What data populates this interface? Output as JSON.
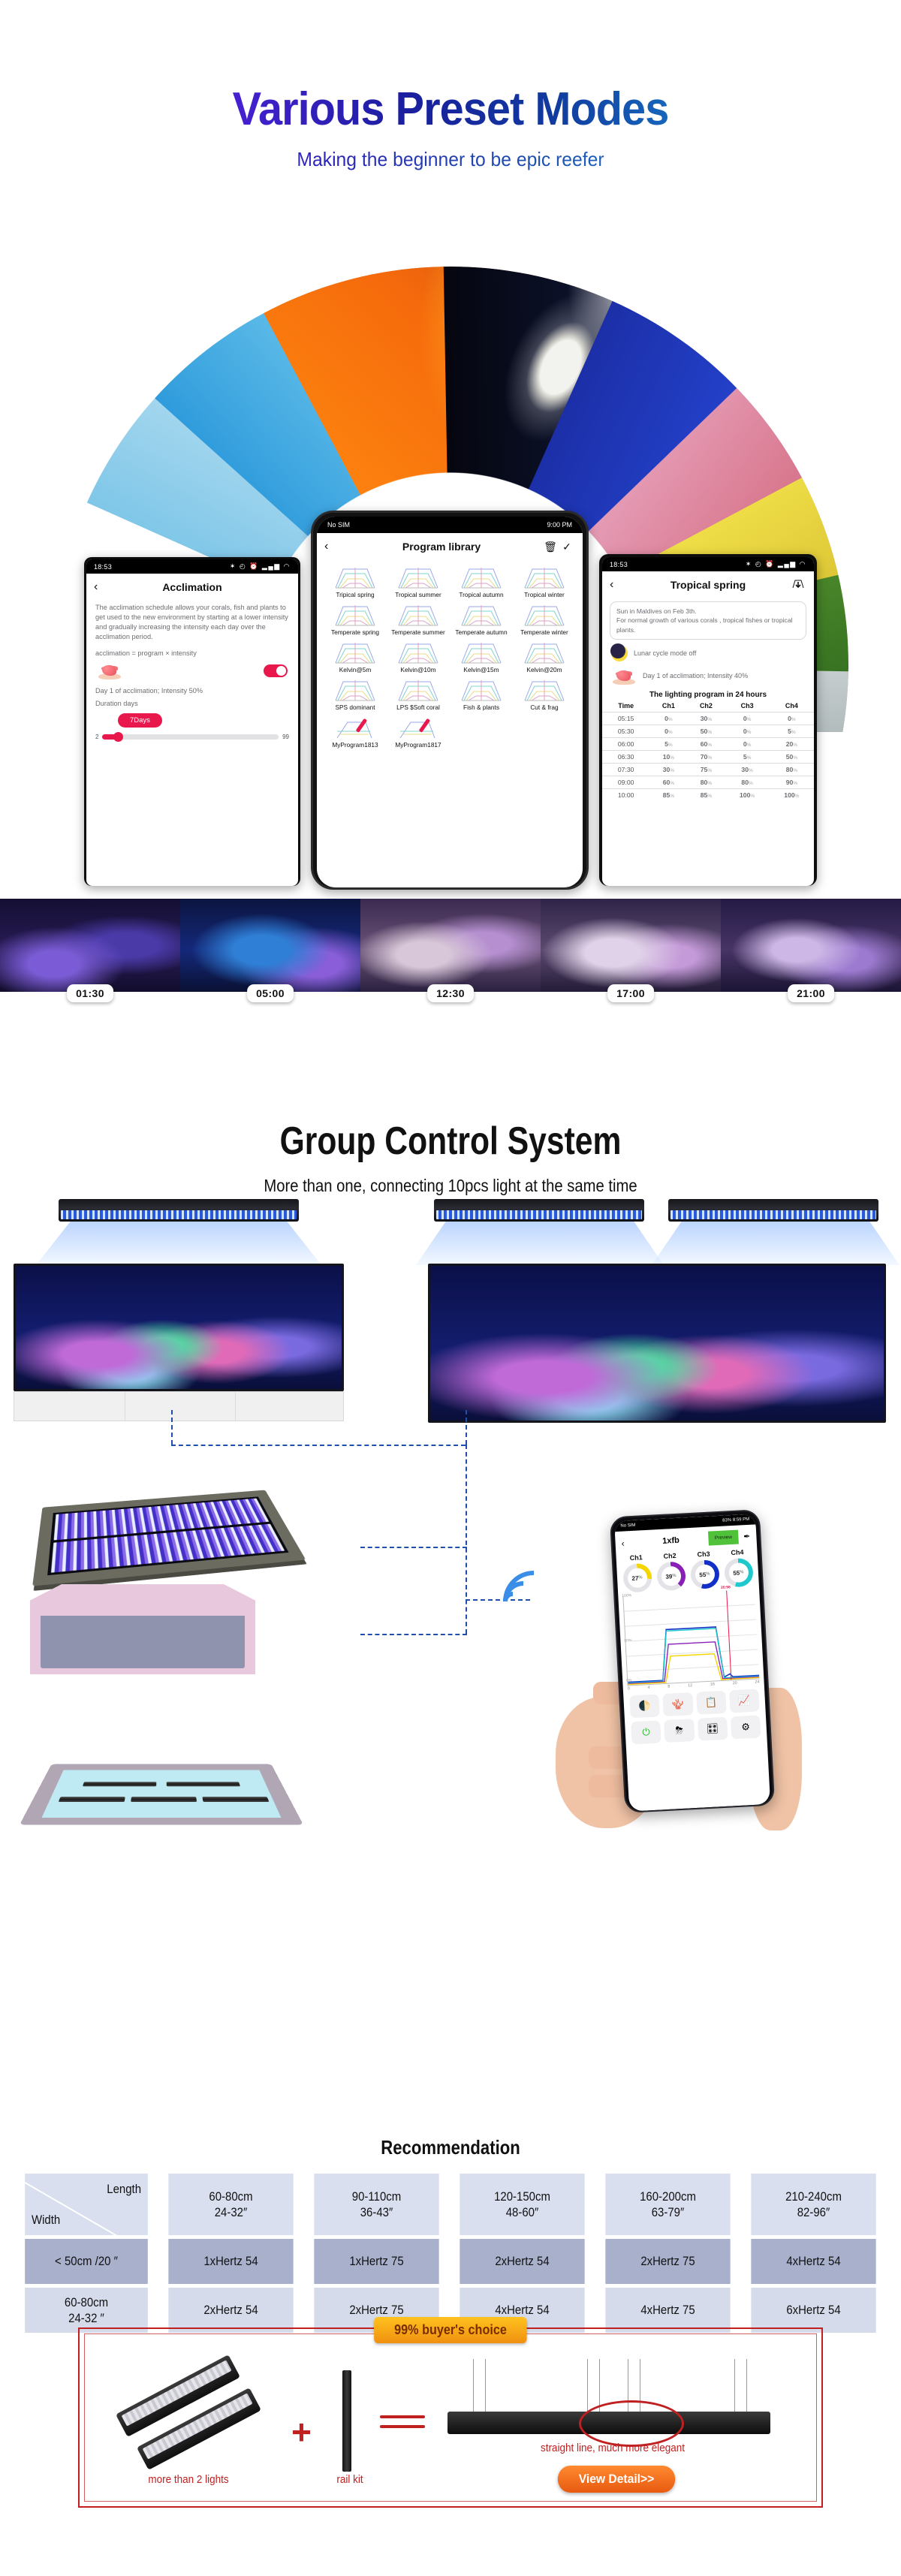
{
  "preset": {
    "title": "Various Preset Modes",
    "subtitle": "Making the beginner to be epic reefer",
    "arc_segments": [
      "water",
      "day-sky",
      "sunset",
      "night-moon",
      "lightning-storm",
      "cherry-blossom",
      "autumn-trees",
      "green-forest",
      "winter-branches",
      "coral-reef"
    ],
    "timeline": [
      {
        "time": "01:30"
      },
      {
        "time": "05:00"
      },
      {
        "time": "12:30"
      },
      {
        "time": "17:00"
      },
      {
        "time": "21:00"
      }
    ]
  },
  "phone_acclimation": {
    "status_time": "18:53",
    "status_icons": "✶ ◴ ⏰ ▂▄▆ ◠",
    "back_icon": "‹",
    "title": "Acclimation",
    "paragraph": "The acclimation schedule allows your corals, fish and plants to get used to the new environment by starting at a lower intensity and gradually increasing the intensity each day over the acclimation period.",
    "formula": "acclimation = program × intensity",
    "day_line": "Day 1 of acclimation; Intensity 50%",
    "duration_label": "Duration days",
    "duration_value": "7Days",
    "slider_min": "2",
    "slider_max": "99",
    "toggle_on": true
  },
  "phone_library": {
    "status_left": "No SIM",
    "status_right": "9:00 PM",
    "back_icon": "‹",
    "title": "Program library",
    "delete_icon": "🗑",
    "confirm_icon": "✓",
    "programs": [
      "Tripical spring",
      "Tropical summer",
      "Tropical autumn",
      "Tropical winter",
      "Temperate spring",
      "Temperate summer",
      "Temperate autumn",
      "Temperate winter",
      "Kelvin@5m",
      "Kelvin@10m",
      "Kelvin@15m",
      "Kelvin@20m",
      "SPS dominant",
      "LPS $Soft coral",
      "Fish & plants",
      "Cut & frag"
    ],
    "custom_programs": [
      "MyProgram1813",
      "MyProgram1817"
    ]
  },
  "phone_program": {
    "status_time": "18:53",
    "status_icons": "✶ ◴ ⏰ ▂▄▆ ◠",
    "back_icon": "‹",
    "title": "Tropical spring",
    "download_icon": "download-curve-icon",
    "description": "Sun in Maldives on Feb 3th.\nFor normal growth of various corals , tropical fishes or tropical plants.",
    "lunar_line": "Lunar cycle mode off",
    "acclimation_line": "Day 1 of acclimation; Intensity 40%",
    "table_title": "The lighting program in 24 hours",
    "columns": [
      "Time",
      "Ch1",
      "Ch2",
      "Ch3",
      "Ch4"
    ],
    "rows": [
      [
        "05:15",
        "0",
        "30",
        "0",
        "0"
      ],
      [
        "05:30",
        "0",
        "50",
        "0",
        "5"
      ],
      [
        "06:00",
        "5",
        "60",
        "0",
        "20"
      ],
      [
        "06:30",
        "10",
        "70",
        "5",
        "50"
      ],
      [
        "07:30",
        "30",
        "75",
        "30",
        "80"
      ],
      [
        "09:00",
        "60",
        "80",
        "80",
        "90"
      ],
      [
        "10:00",
        "85",
        "85",
        "100",
        "100"
      ]
    ],
    "percent_suffix": "%"
  },
  "group": {
    "title": "Group Control System",
    "subtitle": "More than one, connecting 10pcs light at the same time"
  },
  "phone_group": {
    "status_left": "No SIM",
    "status_right": "83%  8:59 PM",
    "back_icon": "‹",
    "title": "1xfb",
    "preview_label": "Preview",
    "edit_icon": "✒",
    "channels": [
      {
        "name": "Ch1",
        "value": "27",
        "unit": "%",
        "color": "#f5d400"
      },
      {
        "name": "Ch2",
        "value": "39",
        "unit": "%",
        "color": "#8a1fb8"
      },
      {
        "name": "Ch3",
        "value": "55",
        "unit": "%",
        "color": "#1230c8"
      },
      {
        "name": "Ch4",
        "value": "55",
        "unit": "%",
        "color": "#1ec8cc"
      }
    ],
    "chart": {
      "y_labels": [
        "100%",
        "50%",
        "0%"
      ],
      "x_ticks": [
        "0",
        "4",
        "8",
        "12",
        "16",
        "20",
        "24"
      ],
      "cursor_label": "20:58"
    },
    "tool_icons": [
      "lunar-cycle-icon",
      "acclimation-coral-icon",
      "program-list-icon",
      "edit-curve-icon",
      "power-icon",
      "storm-cloud-icon",
      "sliders-icon",
      "settings-icon"
    ]
  },
  "recommendation": {
    "title": "Recommendation",
    "corner_length": "Length",
    "corner_width": "Width",
    "length_headers": [
      "60-80cm\n24-32″",
      "90-110cm\n36-43″",
      "120-150cm\n48-60″",
      "160-200cm\n63-79″",
      "210-240cm\n82-96″"
    ],
    "rows": [
      {
        "width": "< 50cm /20 ″",
        "values": [
          "1xHertz 54",
          "1xHertz 75",
          "2xHertz 54",
          "2xHertz 75",
          "4xHertz 54"
        ]
      },
      {
        "width": "60-80cm\n24-32 ″",
        "values": [
          "2xHertz 54",
          "2xHertz 75",
          "4xHertz 54",
          "4xHertz 75",
          "6xHertz 54"
        ]
      }
    ]
  },
  "banner": {
    "ribbon": "99% buyer's choice",
    "caption_lights": "more than 2 lights",
    "caption_rail": "rail kit",
    "caption_elegant": "straight line, much more elegant",
    "cta": "View Detail>>",
    "plus": "+"
  },
  "colors": {
    "accent_pink": "#e8174c",
    "accent_red": "#c02020",
    "accent_orange": "#e85a10",
    "accent_yellow": "#ffc21e",
    "dash_blue": "#1f4fa8",
    "table_head": "#d9dfef",
    "table_dark": "#a9b0cc",
    "table_lite": "#d5dbea"
  }
}
